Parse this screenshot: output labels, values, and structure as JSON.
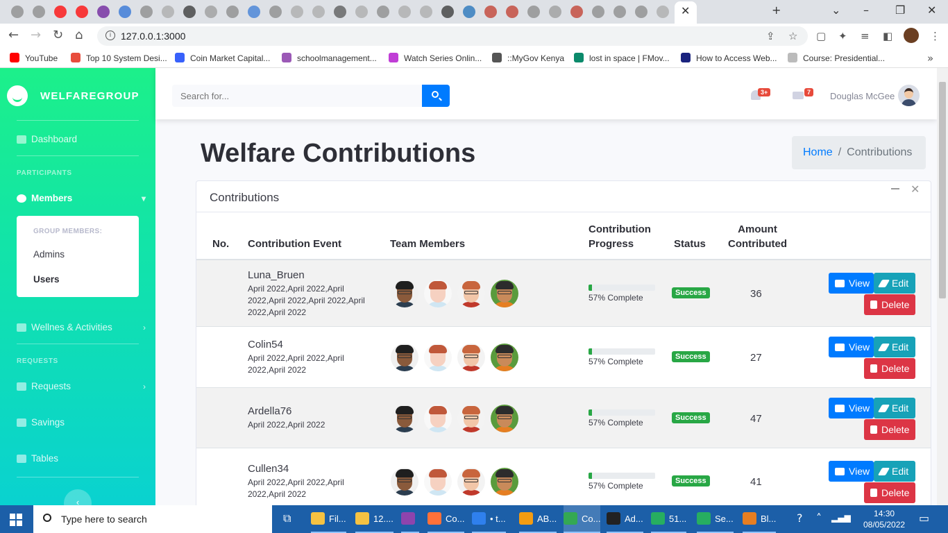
{
  "browser": {
    "url": "127.0.0.1:3000",
    "bookmarks": [
      {
        "label": "YouTube",
        "color": "#ff0000"
      },
      {
        "label": "Top 10 System Desi...",
        "color": "#e84d3d"
      },
      {
        "label": "Coin Market Capital...",
        "color": "#3861fb"
      },
      {
        "label": "schoolmanagement...",
        "color": "#9b59b6"
      },
      {
        "label": "Watch Series Onlin...",
        "color": "#c03ed6"
      },
      {
        "label": "::MyGov Kenya",
        "color": "#555555"
      },
      {
        "label": "lost in space | FMov...",
        "color": "#0b8a6b"
      },
      {
        "label": "How to Access Web...",
        "color": "#1a237e"
      },
      {
        "label": "Course: Presidential...",
        "color": "#bbbbbb"
      }
    ]
  },
  "sidebar": {
    "brand": "WELFAREGROUP",
    "dashboard": "Dashboard",
    "participants_heading": "PARTICIPANTS",
    "members": "Members",
    "submenu_heading": "GROUP MEMBERS:",
    "admins": "Admins",
    "users": "Users",
    "wellness": "Wellnes & Activities",
    "requests_heading": "REQUESTS",
    "requests": "Requests",
    "savings": "Savings",
    "tables": "Tables",
    "toggle": "‹"
  },
  "topbar": {
    "search_placeholder": "Search for...",
    "alerts_count": "3+",
    "messages_count": "7",
    "user_name": "Douglas McGee"
  },
  "header": {
    "title": "Welfare Contributions",
    "breadcrumb_home": "Home",
    "breadcrumb_sep": "/",
    "breadcrumb_current": "Contributions"
  },
  "card": {
    "title": "Contributions",
    "columns": {
      "no": "No.",
      "event": "Contribution Event",
      "team": "Team Members",
      "progress": "Contribution Progress",
      "status": "Status",
      "amount": "Amount Contributed"
    },
    "buttons": {
      "view": "View",
      "edit": "Edit",
      "delete": "Delete"
    },
    "rows": [
      {
        "name": "Luna_Bruen",
        "dates": "April 2022,April 2022,April 2022,April 2022,April 2022,April 2022,April 2022",
        "progress": 0.57,
        "progress_text": "57% Complete",
        "status": "Success",
        "amount": "36"
      },
      {
        "name": "Colin54",
        "dates": "April 2022,April 2022,April 2022,April 2022",
        "progress": 0.57,
        "progress_text": "57% Complete",
        "status": "Success",
        "amount": "27"
      },
      {
        "name": "Ardella76",
        "dates": "April 2022,April 2022",
        "progress": 0.57,
        "progress_text": "57% Complete",
        "status": "Success",
        "amount": "47"
      },
      {
        "name": "Cullen34",
        "dates": "April 2022,April 2022,April 2022,April 2022",
        "progress": 0.57,
        "progress_text": "57% Complete",
        "status": "Success",
        "amount": "41"
      }
    ]
  },
  "taskbar": {
    "search_placeholder": "Type here to search",
    "apps": [
      {
        "label": "Fil...",
        "color": "#f5c242"
      },
      {
        "label": "12....",
        "color": "#f5c242"
      },
      {
        "label": "",
        "color": "#8e44ad"
      },
      {
        "label": "Co...",
        "color": "#ff7139"
      },
      {
        "label": "• t...",
        "color": "#2f80ed"
      },
      {
        "label": "AB...",
        "color": "#f39c12"
      },
      {
        "label": "Co...",
        "color": "#34a853"
      },
      {
        "label": "Ad...",
        "color": "#222222"
      },
      {
        "label": "51...",
        "color": "#27ae60"
      },
      {
        "label": "Se...",
        "color": "#27ae60"
      },
      {
        "label": "Bl...",
        "color": "#e67e22"
      }
    ],
    "time": "14:30",
    "date": "08/05/2022"
  }
}
